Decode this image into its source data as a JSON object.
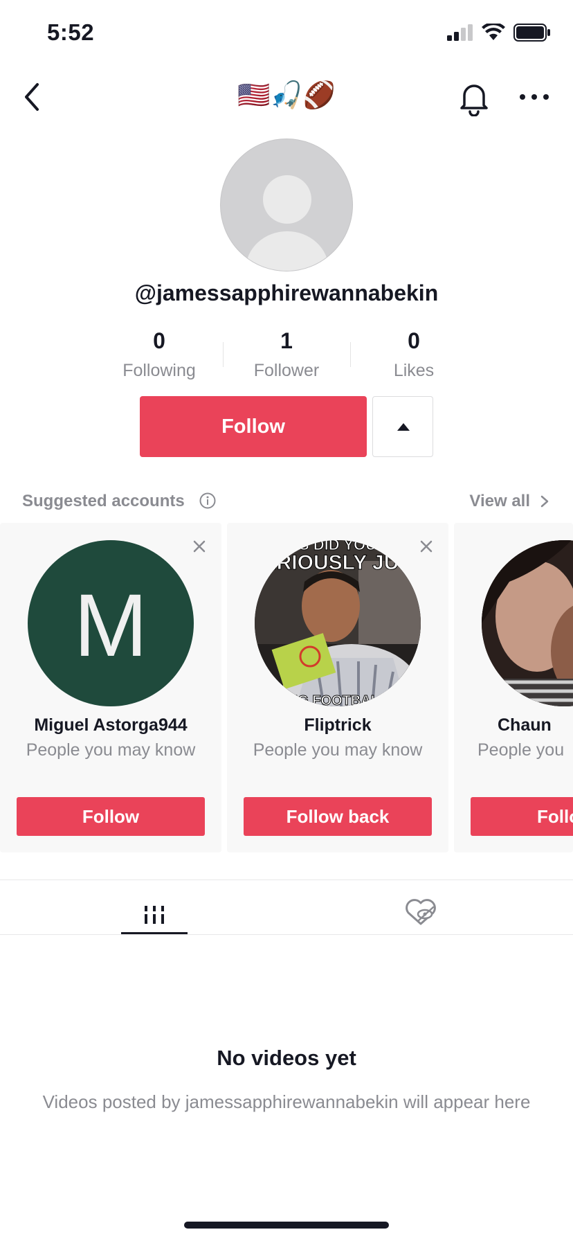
{
  "status_bar": {
    "time": "5:52"
  },
  "nav": {
    "title_emojis": "🇺🇸🎣🏈"
  },
  "profile": {
    "username": "@jamessapphirewannabekin",
    "stats": [
      {
        "value": "0",
        "label": "Following"
      },
      {
        "value": "1",
        "label": "Follower"
      },
      {
        "value": "0",
        "label": "Likes"
      }
    ],
    "follow_label": "Follow"
  },
  "suggested": {
    "title": "Suggested accounts",
    "view_all": "View all",
    "cards": [
      {
        "name": "Miguel Astorga944",
        "subtitle": "People you may know",
        "button": "Follow",
        "avatar_letter": "M",
        "avatar_color": "#1f4a3c"
      },
      {
        "name": "Fliptrick",
        "subtitle": "People you may know",
        "button": "Follow back",
        "meme_top": "S DID YOU",
        "meme_mid": "ERIOUSLY JUS",
        "meme_bottom": "NG FOOTBALL"
      },
      {
        "name": "Chaun",
        "subtitle": "People you",
        "button": "Follo"
      }
    ]
  },
  "empty_state": {
    "title": "No videos yet",
    "subtitle": "Videos posted by jamessapphirewannabekin will appear here"
  },
  "colors": {
    "accent": "#ea4359",
    "text": "#161823",
    "muted": "#8a8b91"
  }
}
